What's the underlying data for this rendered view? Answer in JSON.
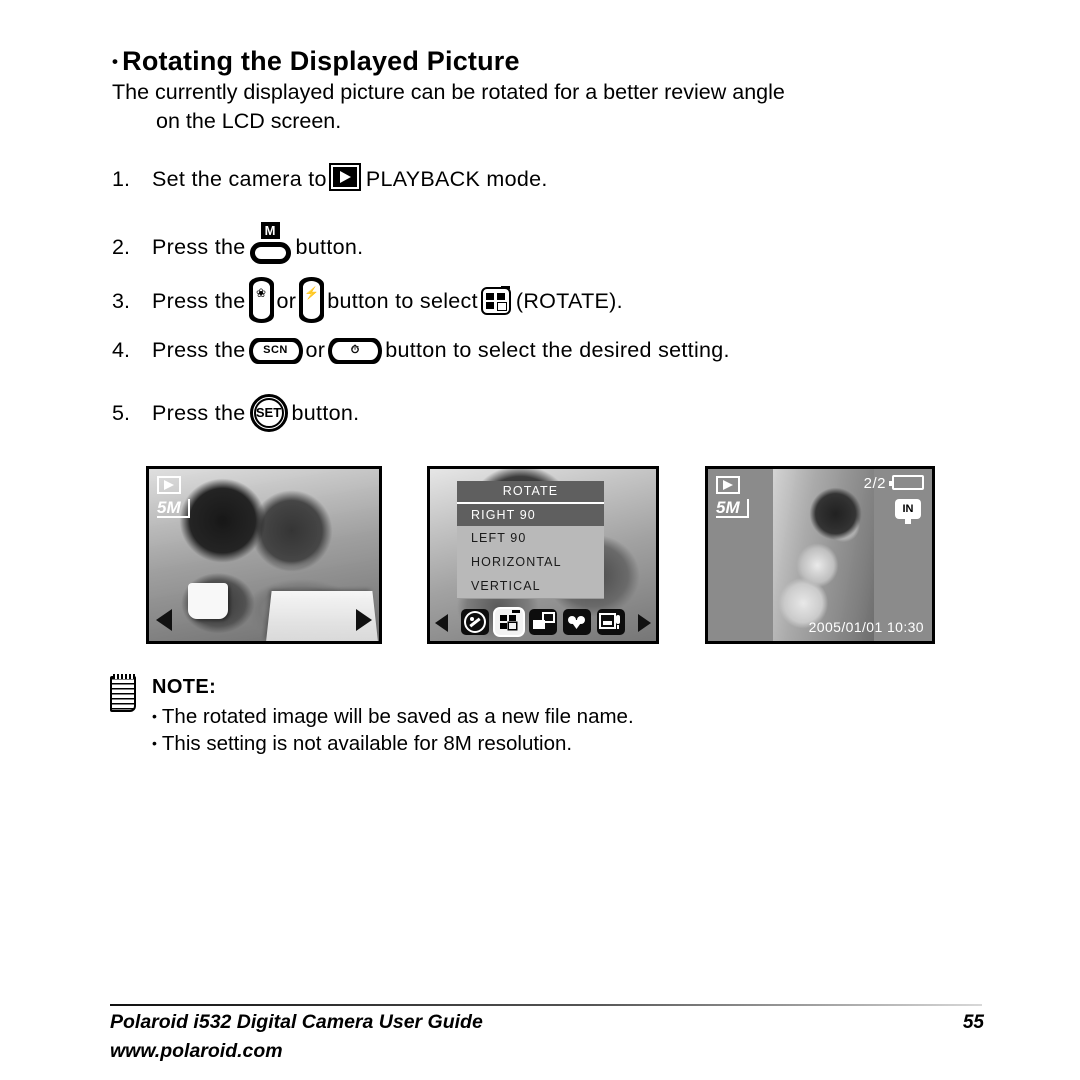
{
  "heading": {
    "bullet": "•",
    "text": "Rotating the Displayed Picture"
  },
  "intro": {
    "line1": "The currently displayed picture can be rotated for a better review angle",
    "line2": "on the LCD screen."
  },
  "steps": [
    {
      "num": "1.",
      "before": "Set the camera to",
      "icon": "playback-icon",
      "after": "PLAYBACK mode."
    },
    {
      "num": "2.",
      "before": "Press the",
      "icon": "menu-button-icon",
      "icon_label": "M",
      "after": "button."
    },
    {
      "num": "3.",
      "before": "Press the",
      "icon_left": "left-rocker-macro-icon",
      "conjunction": "or",
      "icon_right": "right-rocker-flash-icon",
      "middle": "button to select",
      "icon_menu": "rotate-menu-icon",
      "after": "(ROTATE)."
    },
    {
      "num": "4.",
      "before": "Press the",
      "icon_up": "up-rocker-scn-icon",
      "icon_up_label": "SCN",
      "conjunction": "or",
      "icon_down": "down-rocker-timer-icon",
      "after": "button to select the desired setting."
    },
    {
      "num": "5.",
      "before": "Press the",
      "icon": "set-button-icon",
      "icon_label": "SET",
      "after": "button."
    }
  ],
  "screens": {
    "lcd1": {
      "name": "playback-preview",
      "resolution_badge": "5M",
      "mode_icon": "playback-icon"
    },
    "lcd2": {
      "name": "rotate-menu",
      "menu_title": "ROTATE",
      "items": [
        {
          "label": "RIGHT 90",
          "selected": true
        },
        {
          "label": "LEFT 90",
          "selected": false
        },
        {
          "label": "HORIZONTAL",
          "selected": false
        },
        {
          "label": "VERTICAL",
          "selected": false
        }
      ],
      "toolbar_icons": [
        "effect-icon",
        "rotate-icon",
        "resize-icon",
        "favorite-heart-icon",
        "voice-memo-icon"
      ],
      "toolbar_selected": "rotate-icon"
    },
    "lcd3": {
      "name": "rotated-result",
      "resolution_badge": "5M",
      "mode_icon": "playback-icon",
      "counter": "2/2",
      "memory_badge": "IN",
      "timestamp": "2005/01/01  10:30"
    }
  },
  "note": {
    "title": "NOTE:",
    "bullet": "•",
    "lines": [
      "The rotated image will be saved as a new file name.",
      "This setting is not available for 8M resolution."
    ]
  },
  "footer": {
    "title": "Polaroid i532 Digital Camera User Guide",
    "url": "www.polaroid.com",
    "page": "55"
  }
}
